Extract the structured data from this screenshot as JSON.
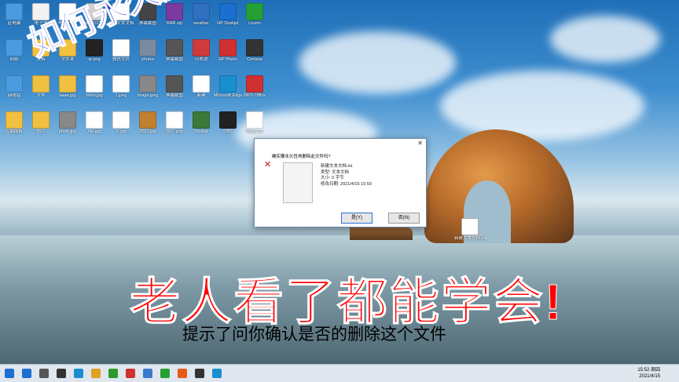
{
  "desktop_icons": [
    {
      "label": "此电脑",
      "color": "#4a9be0"
    },
    {
      "label": "电子书",
      "color": "#f2f2f2"
    },
    {
      "label": "电子书.txt",
      "color": "#ffffff"
    },
    {
      "label": "MX 2021...",
      "color": "#cfcfcf"
    },
    {
      "label": "新建文本文档",
      "color": "#ffffff"
    },
    {
      "label": "屏幕截图",
      "color": "#444"
    },
    {
      "label": "RAR.zip",
      "color": "#7a3aa0"
    },
    {
      "label": "weather",
      "color": "#3070c0"
    },
    {
      "label": "HP Deskjet",
      "color": "#1a6fd0"
    },
    {
      "label": "Lnurm",
      "color": "#25a035"
    },
    {
      "label": "网络",
      "color": "#4a9be0"
    },
    {
      "label": "文档",
      "color": "#f0c040"
    },
    {
      "label": "文件夹",
      "color": "#f0c040"
    },
    {
      "label": "qr.png",
      "color": "#222"
    },
    {
      "label": "微信文件",
      "color": "#fff"
    },
    {
      "label": "photos",
      "color": "#7a8aa0"
    },
    {
      "label": "屏幕截图",
      "color": "#555"
    },
    {
      "label": "日本语",
      "color": "#d03a3a"
    },
    {
      "label": "HP Photo",
      "color": "#d03030"
    },
    {
      "label": "Cortana",
      "color": "#333"
    },
    {
      "label": "回收站",
      "color": "#4a9be0"
    },
    {
      "label": "文件",
      "color": "#f0c040"
    },
    {
      "label": "aaaa.jpg",
      "color": "#f0c040"
    },
    {
      "label": "bbbb.jpg",
      "color": "#fff"
    },
    {
      "label": "1.jpeg",
      "color": "#fff"
    },
    {
      "label": "image.jpeg",
      "color": "#888"
    },
    {
      "label": "屏幕截图",
      "color": "#555"
    },
    {
      "label": "新建",
      "color": "#fff"
    },
    {
      "label": "Microsoft Edge",
      "color": "#1a8fd0"
    },
    {
      "label": "WPS Office",
      "color": "#d03030"
    },
    {
      "label": "控制面板",
      "color": "#f0c040"
    },
    {
      "label": "图片",
      "color": "#f0c040"
    },
    {
      "label": "photo.jpg",
      "color": "#888"
    },
    {
      "label": "file.jpg",
      "color": "#fff"
    },
    {
      "label": "1_jpg",
      "color": "#fff"
    },
    {
      "label": "2021.jpg",
      "color": "#c08030"
    },
    {
      "label": "图片.png",
      "color": "#fff"
    },
    {
      "label": "Ocultar",
      "color": "#3a7a3a"
    },
    {
      "label": "OBS",
      "color": "#222"
    },
    {
      "label": "新建文本",
      "color": "#fff"
    }
  ],
  "dialog": {
    "title": "确实要永久性地删除此文件吗?",
    "file_name": "新建文本文档.txt",
    "type": "类型: 文本文档",
    "size": "大小: 0 字节",
    "date": "修改日期: 2021/4/15 15:50",
    "yes": "是(Y)",
    "no": "否(N)"
  },
  "overlay": {
    "blue_text": "如何永久删除电脑上的文件?",
    "red_text": "老人看了都能学会!",
    "subtitle": "提示了问你确认是否的删除这个文件"
  },
  "right_icon": {
    "label": "新建文本文档.txt"
  },
  "taskbar": {
    "time": "15:52 周四",
    "date": "2021/4/15",
    "icons": [
      "#1a6fd0",
      "#555",
      "#333",
      "#1a8fd0",
      "#e0a020",
      "#2a9a2a",
      "#d03030",
      "#3a7ad0",
      "#25a035",
      "#e85a1a",
      "#333",
      "#1a8fd0"
    ]
  }
}
